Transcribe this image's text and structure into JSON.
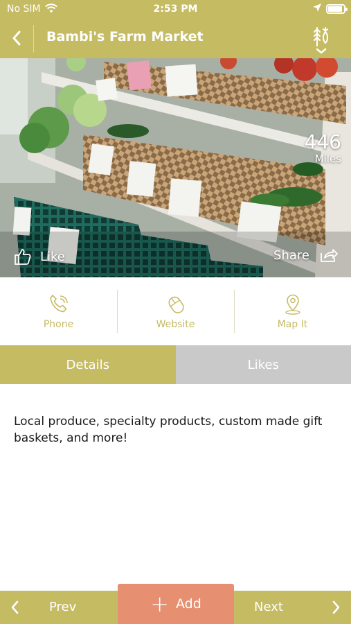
{
  "status_bar": {
    "carrier": "No SIM",
    "time": "2:53 PM"
  },
  "nav": {
    "title": "Bambi's Farm Market"
  },
  "hero": {
    "distance_value": "446",
    "distance_unit": "Miles",
    "like_label": "Like",
    "share_label": "Share"
  },
  "actions": [
    {
      "label": "Phone",
      "icon": "phone-icon"
    },
    {
      "label": "Website",
      "icon": "mouse-icon"
    },
    {
      "label": "Map It",
      "icon": "map-pin-icon"
    }
  ],
  "tabs": [
    {
      "label": "Details",
      "active": true
    },
    {
      "label": "Likes",
      "active": false
    }
  ],
  "details_text": "Local produce, specialty products, custom made gift baskets, and more!",
  "bottom_bar": {
    "prev_label": "Prev",
    "add_label": "Add",
    "next_label": "Next"
  },
  "colors": {
    "brand": "#c5bb63",
    "add_button": "#e78f71",
    "inactive_tab": "#c9c9c9"
  }
}
